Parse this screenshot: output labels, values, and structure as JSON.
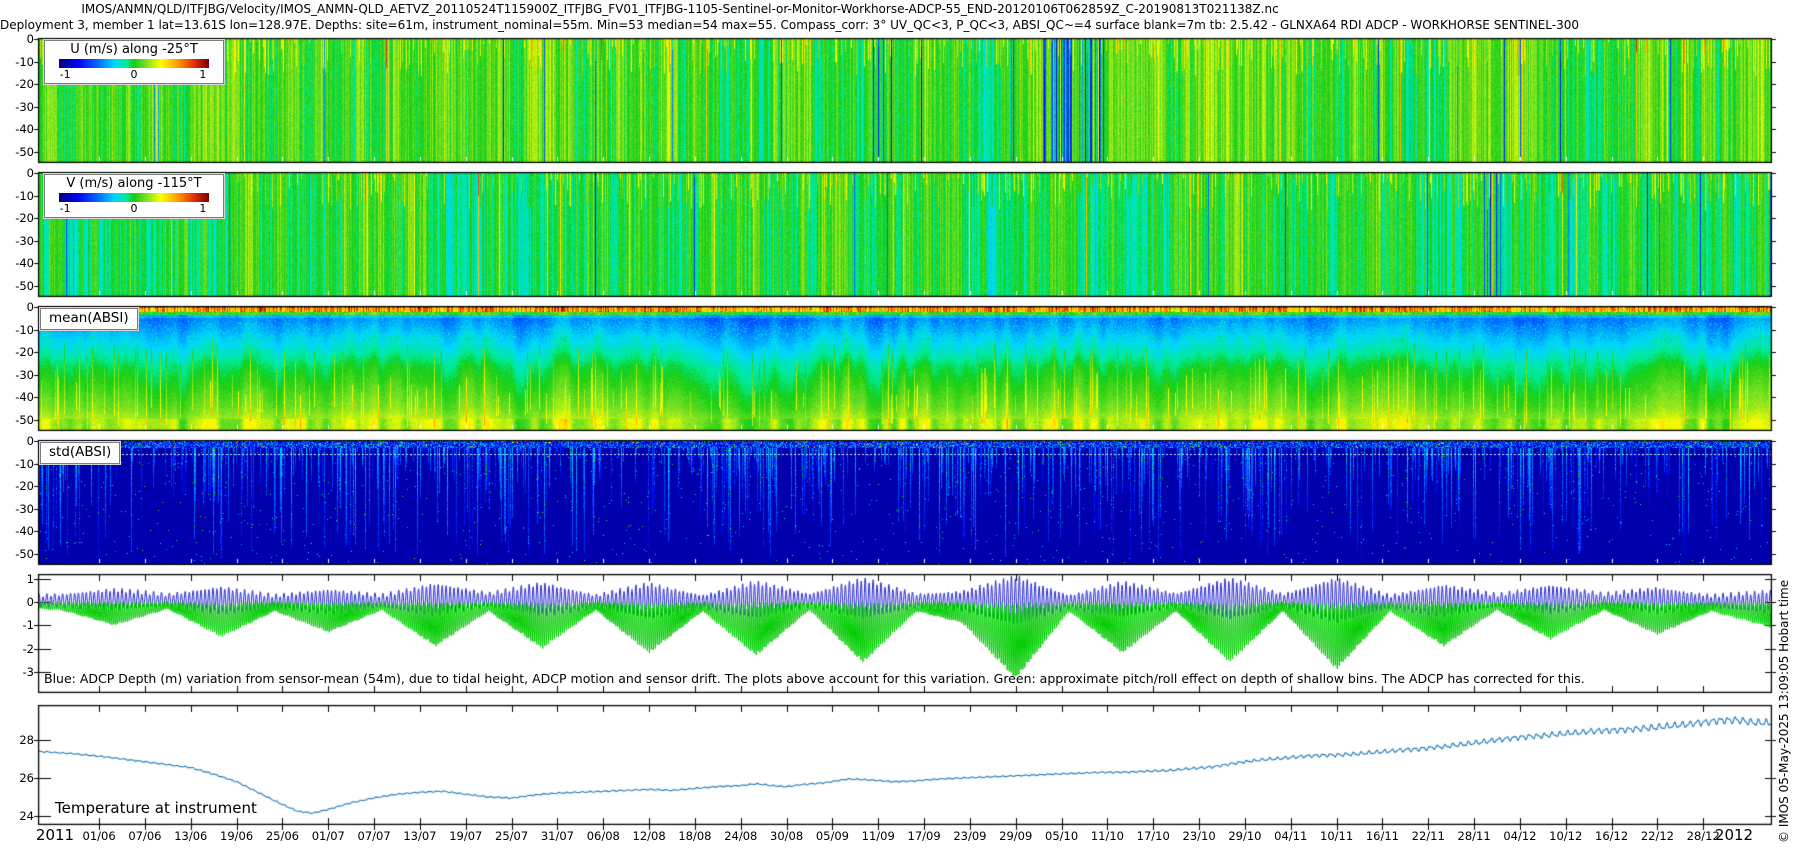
{
  "header": {
    "title": "IMOS/ANMN/QLD/ITFJBG/Velocity/IMOS_ANMN-QLD_AETVZ_20110524T115900Z_ITFJBG_FV01_ITFJBG-1105-Sentinel-or-Monitor-Workhorse-ADCP-55_END-20120106T062859Z_C-20190813T021138Z.nc",
    "subtitle": "Deployment 3, member 1 lat=13.61S lon=128.97E. Depths: site=61m, instrument_nominal=55m. Min=53 median=54 max=55. Compass_corr: 3° UV_QC<3, P_QC<3, ABSI_QC~=4 surface blank=7m tb: 2.5.42 - GLNXA64 RDI ADCP - WORKHORSE SENTINEL-300"
  },
  "legends": {
    "u": {
      "label": "U (m/s) along -25°T",
      "ticks": [
        "-1",
        "0",
        "1"
      ]
    },
    "v": {
      "label": "V (m/s) along -115°T",
      "ticks": [
        "-1",
        "0",
        "1"
      ]
    }
  },
  "panel_labels": {
    "mean_absi": "mean(ABSI)",
    "std_absi": "std(ABSI)",
    "temperature": "Temperature at instrument"
  },
  "annotation": "Blue: ADCP Depth (m) variation from sensor-mean (54m), due to tidal height, ADCP motion and sensor drift. The plots above account for this variation. Green: approximate pitch/roll effect on depth of shallow bins. The ADCP has corrected for this.",
  "copyright": "© IMOS 05-May-2025 13:09:05 Hobart time",
  "axis": {
    "year_left": "2011",
    "year_right": "2012",
    "xticks": [
      "01/06",
      "07/06",
      "13/06",
      "19/06",
      "25/06",
      "01/07",
      "07/07",
      "13/07",
      "19/07",
      "25/07",
      "31/07",
      "06/08",
      "12/08",
      "18/08",
      "24/08",
      "30/08",
      "05/09",
      "11/09",
      "17/09",
      "23/09",
      "29/09",
      "05/10",
      "11/10",
      "17/10",
      "23/10",
      "29/10",
      "04/11",
      "10/11",
      "16/11",
      "22/11",
      "28/11",
      "04/12",
      "10/12",
      "16/12",
      "22/12",
      "28/12"
    ],
    "depth_yticks": [
      0,
      -10,
      -20,
      -30,
      -40,
      -50
    ],
    "depthvar_yticks": [
      1,
      0,
      -1,
      -2,
      -3
    ],
    "temp_yticks": [
      28,
      26,
      24
    ]
  },
  "colors": {
    "axis": "#000000",
    "temp_line": "#1f77b4",
    "depth_blue": "#2b2bd0",
    "pitch_green": "#00cc00",
    "std_background": "#000090"
  },
  "chart_data": [
    {
      "type": "heatmap",
      "title": "U (m/s) along -25°T",
      "colormap": "jet",
      "value_range_mps": [
        -1.2,
        1.2
      ],
      "colorbar_ticks": [
        -1,
        0,
        1
      ],
      "depth_range_m": [
        0,
        -50
      ],
      "x_range": [
        "2011-05-24",
        "2012-01-06"
      ],
      "description": "Rotated velocity component; densely striped tidal signal, mostly 0 to +0.3 m/s (green/yellow-green) over full depth, with sparse dark-blue negative events clustered near early September and early-mid October."
    },
    {
      "type": "heatmap",
      "title": "V (m/s) along -115°T",
      "colormap": "jet",
      "value_range_mps": [
        -1.2,
        1.2
      ],
      "colorbar_ticks": [
        -1,
        0,
        1
      ],
      "depth_range_m": [
        0,
        -50
      ],
      "x_range": [
        "2011-05-24",
        "2012-01-06"
      ],
      "description": "Rotated velocity component; more uniform green (near 0 m/s) striping with occasional dark negative columns."
    },
    {
      "type": "heatmap",
      "title": "mean(ABSI)",
      "colormap": "jet",
      "depth_range_m": [
        0,
        -50
      ],
      "x_range": [
        "2011-05-24",
        "2012-01-06"
      ],
      "structure": {
        "surface_band": "very high backscatter (yellow/orange/red) in top ~3 m",
        "upper": "low (blue) from ~5 m to ~15 m",
        "mid": "gradient cyan to green from ~15 m to ~40 m",
        "bottom": "yellow-green band below ~45 m near the instrument"
      }
    },
    {
      "type": "heatmap",
      "title": "std(ABSI)",
      "colormap": "jet",
      "depth_range_m": [
        0,
        -50
      ],
      "x_range": [
        "2011-05-24",
        "2012-01-06"
      ],
      "description": "Mostly low variance (dark navy) with intermittent vertical cyan/blue streaks of varying depth; mottled high-variance band in top ~4 m with a white dotted line near 6 m depth."
    },
    {
      "type": "line",
      "title": "ADCP depth variation and pitch/roll effect",
      "ylim": [
        -3.9,
        1.3
      ],
      "yticks": [
        1,
        0,
        -1,
        -2,
        -3
      ],
      "x_unit": "days since 2011-05-24",
      "tidal_period_days": 0.5175,
      "spring_neap_period_days": 14.77,
      "series": [
        {
          "name": "ADCP depth variation from sensor-mean (54m)",
          "color": "#2b2bd0"
        },
        {
          "name": "approximate pitch/roll effect on shallow-bin depth",
          "color": "#00cc00"
        }
      ],
      "spring_spike_depths": [
        [
          0,
          -0.3
        ],
        [
          3,
          -0.35
        ],
        [
          10,
          -1.0
        ],
        [
          17,
          -0.3
        ],
        [
          24,
          -1.5
        ],
        [
          31,
          -0.4
        ],
        [
          38,
          -1.3
        ],
        [
          45,
          -0.35
        ],
        [
          52,
          -1.9
        ],
        [
          59,
          -0.4
        ],
        [
          66,
          -2.0
        ],
        [
          73,
          -0.35
        ],
        [
          80,
          -2.2
        ],
        [
          87,
          -0.4
        ],
        [
          94,
          -2.3
        ],
        [
          101,
          -0.35
        ],
        [
          108,
          -2.6
        ],
        [
          115,
          -0.4
        ],
        [
          121,
          -0.9
        ],
        [
          128,
          -3.3
        ],
        [
          135,
          -0.4
        ],
        [
          142,
          -2.2
        ],
        [
          149,
          -0.4
        ],
        [
          156,
          -2.6
        ],
        [
          163,
          -0.4
        ],
        [
          170,
          -2.9
        ],
        [
          177,
          -0.4
        ],
        [
          184,
          -1.9
        ],
        [
          191,
          -0.35
        ],
        [
          198,
          -1.6
        ],
        [
          205,
          -0.35
        ],
        [
          212,
          -1.4
        ],
        [
          219,
          -0.4
        ],
        [
          227,
          -1.1
        ]
      ]
    },
    {
      "type": "line",
      "title": "Temperature at instrument",
      "ylim": [
        23.5,
        29.8
      ],
      "yticks": [
        24,
        26,
        28
      ],
      "color": "#1f77b4",
      "x_unit": "days since 2011-05-24",
      "points": [
        [
          0,
          27.4
        ],
        [
          4,
          27.3
        ],
        [
          8,
          27.15
        ],
        [
          12,
          26.95
        ],
        [
          14,
          26.85
        ],
        [
          17,
          26.7
        ],
        [
          20,
          26.55
        ],
        [
          23,
          26.2
        ],
        [
          26,
          25.8
        ],
        [
          29,
          25.2
        ],
        [
          32,
          24.6
        ],
        [
          34,
          24.25
        ],
        [
          36,
          24.15
        ],
        [
          38,
          24.35
        ],
        [
          41,
          24.7
        ],
        [
          44,
          24.95
        ],
        [
          47,
          25.15
        ],
        [
          50,
          25.25
        ],
        [
          53,
          25.3
        ],
        [
          56,
          25.15
        ],
        [
          59,
          25.0
        ],
        [
          62,
          24.95
        ],
        [
          64,
          25.05
        ],
        [
          66,
          25.15
        ],
        [
          68,
          25.2
        ],
        [
          71,
          25.25
        ],
        [
          74,
          25.3
        ],
        [
          77,
          25.35
        ],
        [
          80,
          25.4
        ],
        [
          83,
          25.35
        ],
        [
          86,
          25.45
        ],
        [
          89,
          25.55
        ],
        [
          92,
          25.6
        ],
        [
          94,
          25.7
        ],
        [
          96,
          25.6
        ],
        [
          98,
          25.55
        ],
        [
          100,
          25.65
        ],
        [
          103,
          25.75
        ],
        [
          106,
          25.95
        ],
        [
          109,
          25.9
        ],
        [
          112,
          25.8
        ],
        [
          115,
          25.85
        ],
        [
          118,
          25.95
        ],
        [
          121,
          26.0
        ],
        [
          124,
          26.05
        ],
        [
          127,
          26.1
        ],
        [
          130,
          26.15
        ],
        [
          133,
          26.2
        ],
        [
          136,
          26.25
        ],
        [
          139,
          26.3
        ],
        [
          142,
          26.3
        ],
        [
          145,
          26.35
        ],
        [
          148,
          26.4
        ],
        [
          151,
          26.5
        ],
        [
          154,
          26.6
        ],
        [
          157,
          26.8
        ],
        [
          160,
          26.95
        ],
        [
          163,
          27.05
        ],
        [
          166,
          27.15
        ],
        [
          169,
          27.2
        ],
        [
          172,
          27.25
        ],
        [
          175,
          27.35
        ],
        [
          178,
          27.45
        ],
        [
          181,
          27.55
        ],
        [
          184,
          27.65
        ],
        [
          187,
          27.8
        ],
        [
          190,
          27.95
        ],
        [
          193,
          28.1
        ],
        [
          196,
          28.2
        ],
        [
          199,
          28.3
        ],
        [
          202,
          28.4
        ],
        [
          205,
          28.5
        ],
        [
          208,
          28.55
        ],
        [
          211,
          28.65
        ],
        [
          214,
          28.75
        ],
        [
          217,
          28.9
        ],
        [
          220,
          29.0
        ],
        [
          222,
          29.05
        ],
        [
          224,
          28.95
        ],
        [
          227,
          28.9
        ]
      ]
    }
  ]
}
